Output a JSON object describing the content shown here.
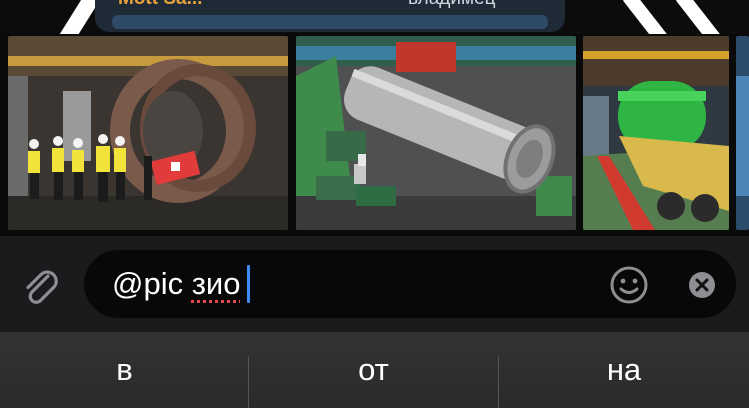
{
  "message": {
    "title": "Mott Sa...",
    "author": "владимец"
  },
  "results": {
    "items": [
      {
        "name": "result-image-1"
      },
      {
        "name": "result-image-2"
      },
      {
        "name": "result-image-3"
      },
      {
        "name": "result-image-4"
      }
    ]
  },
  "input": {
    "mention": "@pic ",
    "query": "зио"
  },
  "icons": {
    "attach": "paperclip-icon",
    "emoji": "smiley-icon",
    "clear": "clear-x-icon"
  },
  "keyboard": {
    "suggestions": [
      "в",
      "от",
      "на"
    ]
  },
  "colors": {
    "caret": "#3e8cf7",
    "spell_underline": "#e5484d",
    "title_accent": "#e9a13b"
  }
}
